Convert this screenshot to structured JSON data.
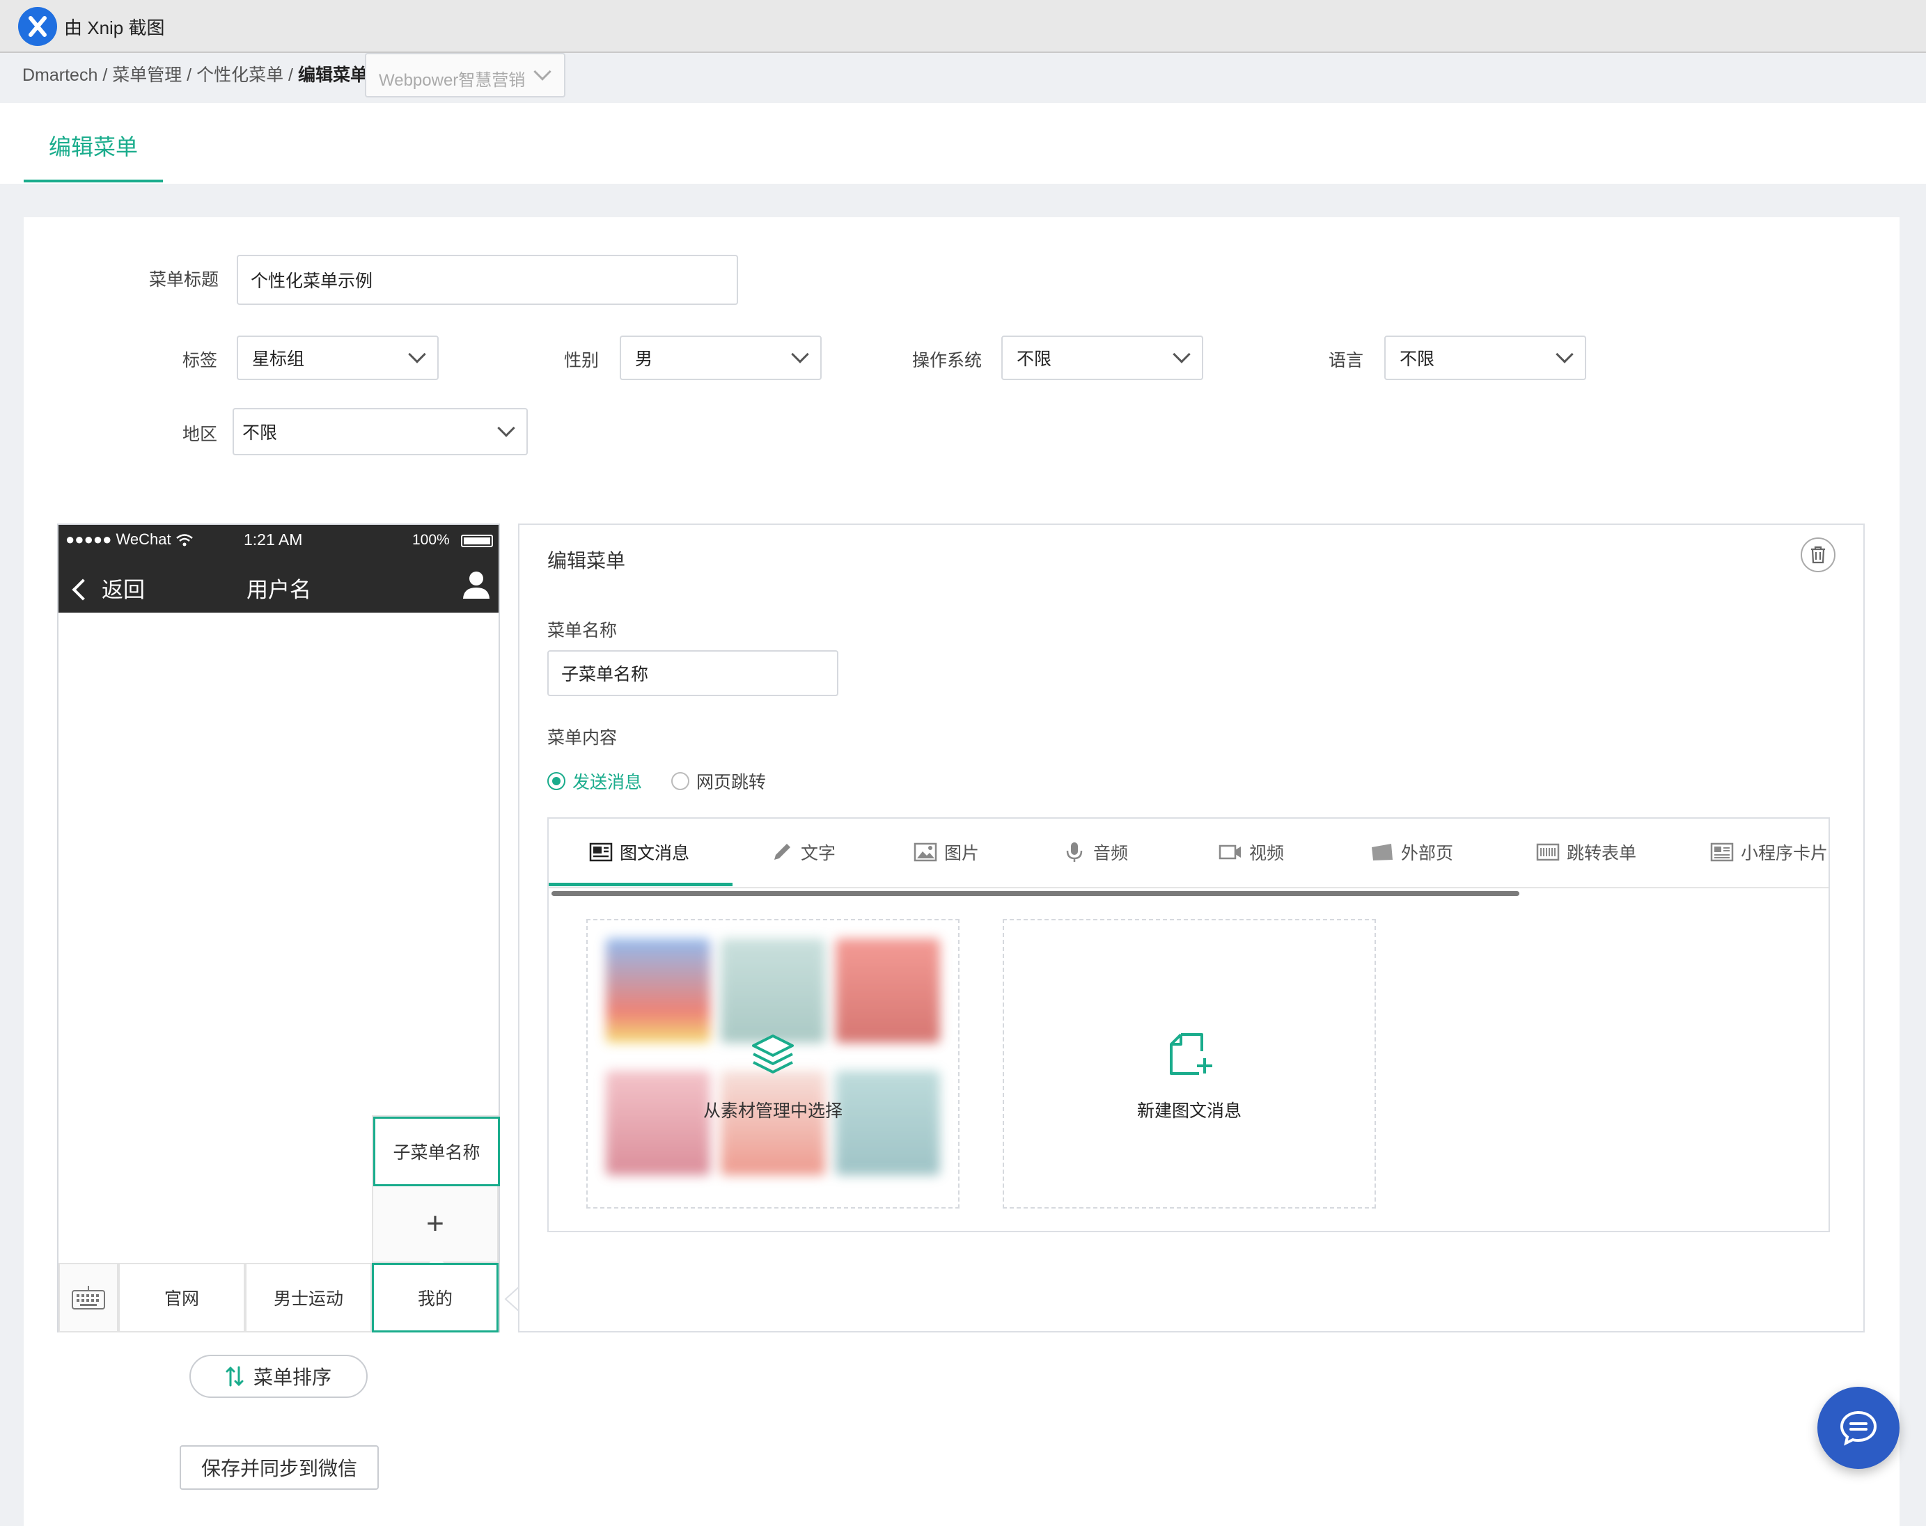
{
  "titlebar": {
    "text": "由 Xnip 截图"
  },
  "breadcrumb": {
    "items": [
      "Dmartech",
      "菜单管理",
      "个性化菜单"
    ],
    "current": "编辑菜单",
    "separator": " / "
  },
  "account_select": {
    "value": "Webpower智慧营销"
  },
  "page_tab": {
    "label": "编辑菜单"
  },
  "form": {
    "title_label": "菜单标题",
    "title_value": "个性化菜单示例",
    "tag_label": "标签",
    "tag_value": "星标组",
    "gender_label": "性别",
    "gender_value": "男",
    "os_label": "操作系统",
    "os_value": "不限",
    "language_label": "语言",
    "language_value": "不限",
    "region_label": "地区",
    "region_value": "不限"
  },
  "phone": {
    "status_carrier": "●●●●● WeChat",
    "status_time": "1:21 AM",
    "status_battery": "100%",
    "back_label": "返回",
    "title": "用户名",
    "menus": [
      "官网",
      "男士运动",
      "我的"
    ],
    "submenu_item": "子菜单名称",
    "submenu_add": "+"
  },
  "sort_button": {
    "label": "菜单排序"
  },
  "save_button": {
    "label": "保存并同步到微信"
  },
  "editor": {
    "title": "编辑菜单",
    "name_label": "菜单名称",
    "name_value": "子菜单名称",
    "content_label": "菜单内容",
    "radio_send": "发送消息",
    "radio_web": "网页跳转",
    "tabs": [
      "图文消息",
      "文字",
      "图片",
      "音频",
      "视频",
      "外部页",
      "跳转表单",
      "小程序卡片"
    ],
    "library_label": "从素材管理中选择",
    "new_label": "新建图文消息"
  },
  "colors": {
    "accent": "#1aac8c",
    "fab": "#2c5cc5",
    "phone_bar": "#2b2b2b"
  }
}
